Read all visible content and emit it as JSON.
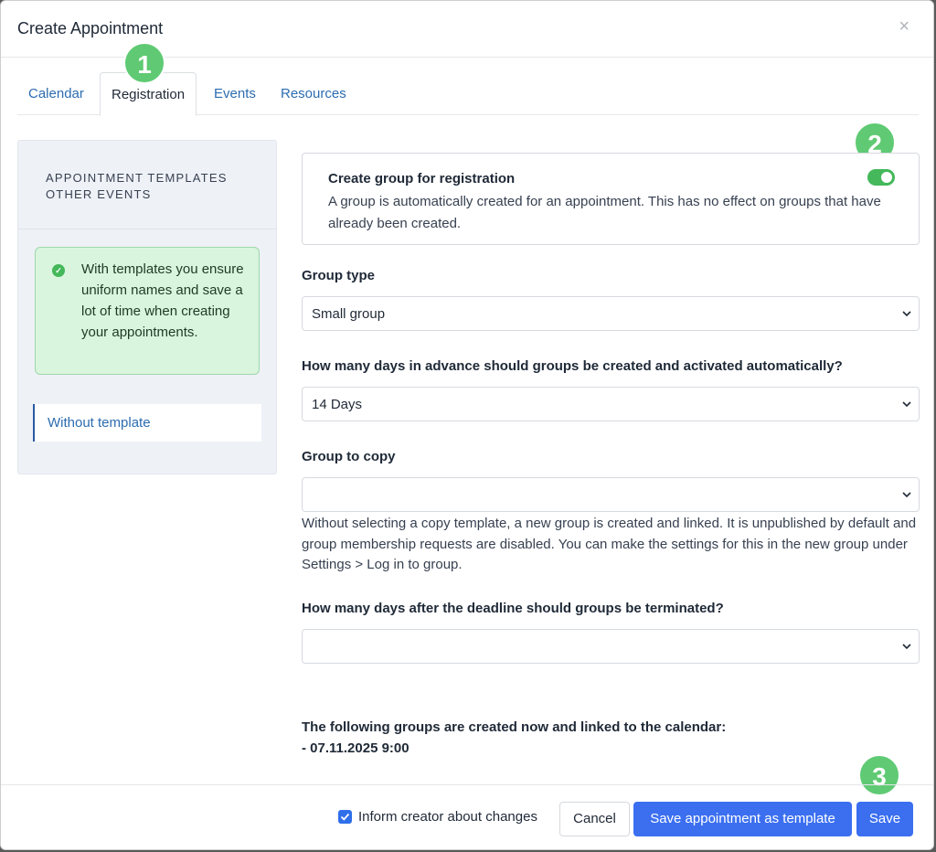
{
  "modal": {
    "title": "Create Appointment",
    "close_glyph": "×"
  },
  "tabs": [
    {
      "label": "Calendar",
      "active": false
    },
    {
      "label": "Registration",
      "active": true
    },
    {
      "label": "Events",
      "active": false
    },
    {
      "label": "Resources",
      "active": false
    }
  ],
  "badges": [
    "1",
    "2",
    "3"
  ],
  "sidebar": {
    "heading_line1": "APPOINTMENT TEMPLATES",
    "heading_line2": "OTHER EVENTS",
    "alert_text": "With templates you ensure uniform names and save a lot of time when creating your appointments.",
    "items": [
      {
        "label": "Without template",
        "selected": true
      }
    ]
  },
  "group_card": {
    "title": "Create group for registration",
    "description": "A group is automatically created for an appointment. This has no effect on groups that have already been created.",
    "toggle_on": true
  },
  "fields": {
    "group_type": {
      "label": "Group type",
      "value": "Small group"
    },
    "days_in_advance": {
      "label": "How many days in advance should groups be created and activated automatically?",
      "value": "14 Days"
    },
    "group_to_copy": {
      "label": "Group to copy",
      "value": "",
      "help": "Without selecting a copy template, a new group is created and linked. It is unpublished by default and group membership requests are disabled. You can make the settings for this in the new group under Settings > Log in to group."
    },
    "days_after_deadline": {
      "label": "How many days after the deadline should groups be terminated?",
      "value": ""
    }
  },
  "summary": {
    "heading": "The following groups are created now and linked to the calendar:",
    "items": [
      "- 07.11.2025 9:00"
    ]
  },
  "footer": {
    "inform_label": "Inform creator about changes",
    "inform_checked": true,
    "cancel_label": "Cancel",
    "save_template_label": "Save appointment as template",
    "save_label": "Save"
  },
  "colors": {
    "accent": "#3b6ff0",
    "badge": "#5fca73",
    "toggle_on": "#44b85a",
    "link": "#2c6cb0",
    "alert_bg": "#d9f5de"
  }
}
